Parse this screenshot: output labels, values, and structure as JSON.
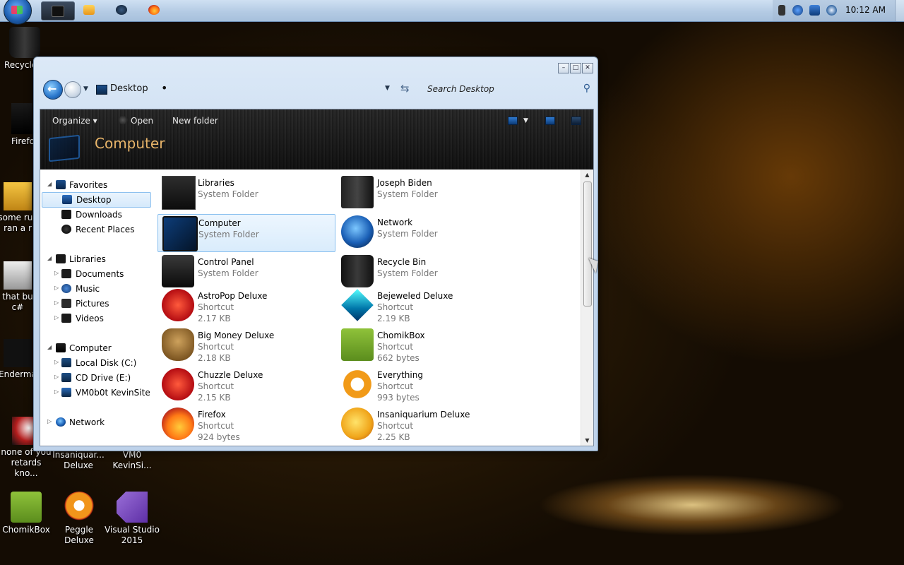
{
  "taskbar": {
    "clock": "10:12 AM"
  },
  "desktop": {
    "icons": [
      {
        "label": "Recycle"
      },
      {
        "label": "Firefo"
      },
      {
        "label": "some rus ran a r"
      },
      {
        "label": "that bu c#"
      },
      {
        "label": "Enderma"
      },
      {
        "label": "none of you retards kno..."
      },
      {
        "label": "Insaniquar... Deluxe"
      },
      {
        "label": "VM0 KevinSi..."
      },
      {
        "label": "ChomikBox"
      },
      {
        "label": "Peggle Deluxe"
      },
      {
        "label": "Visual Studio 2015"
      }
    ]
  },
  "window": {
    "address": "Desktop",
    "search_placeholder": "Search Desktop",
    "toolbar": {
      "organize": "Organize",
      "open": "Open",
      "new_folder": "New folder"
    },
    "header_title": "Computer",
    "nav": {
      "favorites": "Favorites",
      "desktop": "Desktop",
      "downloads": "Downloads",
      "recent_places": "Recent Places",
      "libraries": "Libraries",
      "documents": "Documents",
      "music": "Music",
      "pictures": "Pictures",
      "videos": "Videos",
      "computer": "Computer",
      "local_disk": "Local Disk (C:)",
      "cd_drive": "CD Drive (E:)",
      "vm_site": "VM0b0t KevinSite",
      "network": "Network"
    },
    "files": [
      {
        "name": "Libraries",
        "type": "System Folder",
        "size": ""
      },
      {
        "name": "Joseph Biden",
        "type": "System Folder",
        "size": ""
      },
      {
        "name": "Computer",
        "type": "System Folder",
        "size": ""
      },
      {
        "name": "Network",
        "type": "System Folder",
        "size": ""
      },
      {
        "name": "Control Panel",
        "type": "System Folder",
        "size": ""
      },
      {
        "name": "Recycle Bin",
        "type": "System Folder",
        "size": ""
      },
      {
        "name": "AstroPop Deluxe",
        "type": "Shortcut",
        "size": "2.17 KB"
      },
      {
        "name": "Bejeweled Deluxe",
        "type": "Shortcut",
        "size": "2.19 KB"
      },
      {
        "name": "Big Money Deluxe",
        "type": "Shortcut",
        "size": "2.18 KB"
      },
      {
        "name": "ChomikBox",
        "type": "Shortcut",
        "size": "662 bytes"
      },
      {
        "name": "Chuzzle Deluxe",
        "type": "Shortcut",
        "size": "2.15 KB"
      },
      {
        "name": "Everything",
        "type": "Shortcut",
        "size": "993 bytes"
      },
      {
        "name": "Firefox",
        "type": "Shortcut",
        "size": "924 bytes"
      },
      {
        "name": "Insaniquarium Deluxe",
        "type": "Shortcut",
        "size": "2.25 KB"
      }
    ]
  }
}
